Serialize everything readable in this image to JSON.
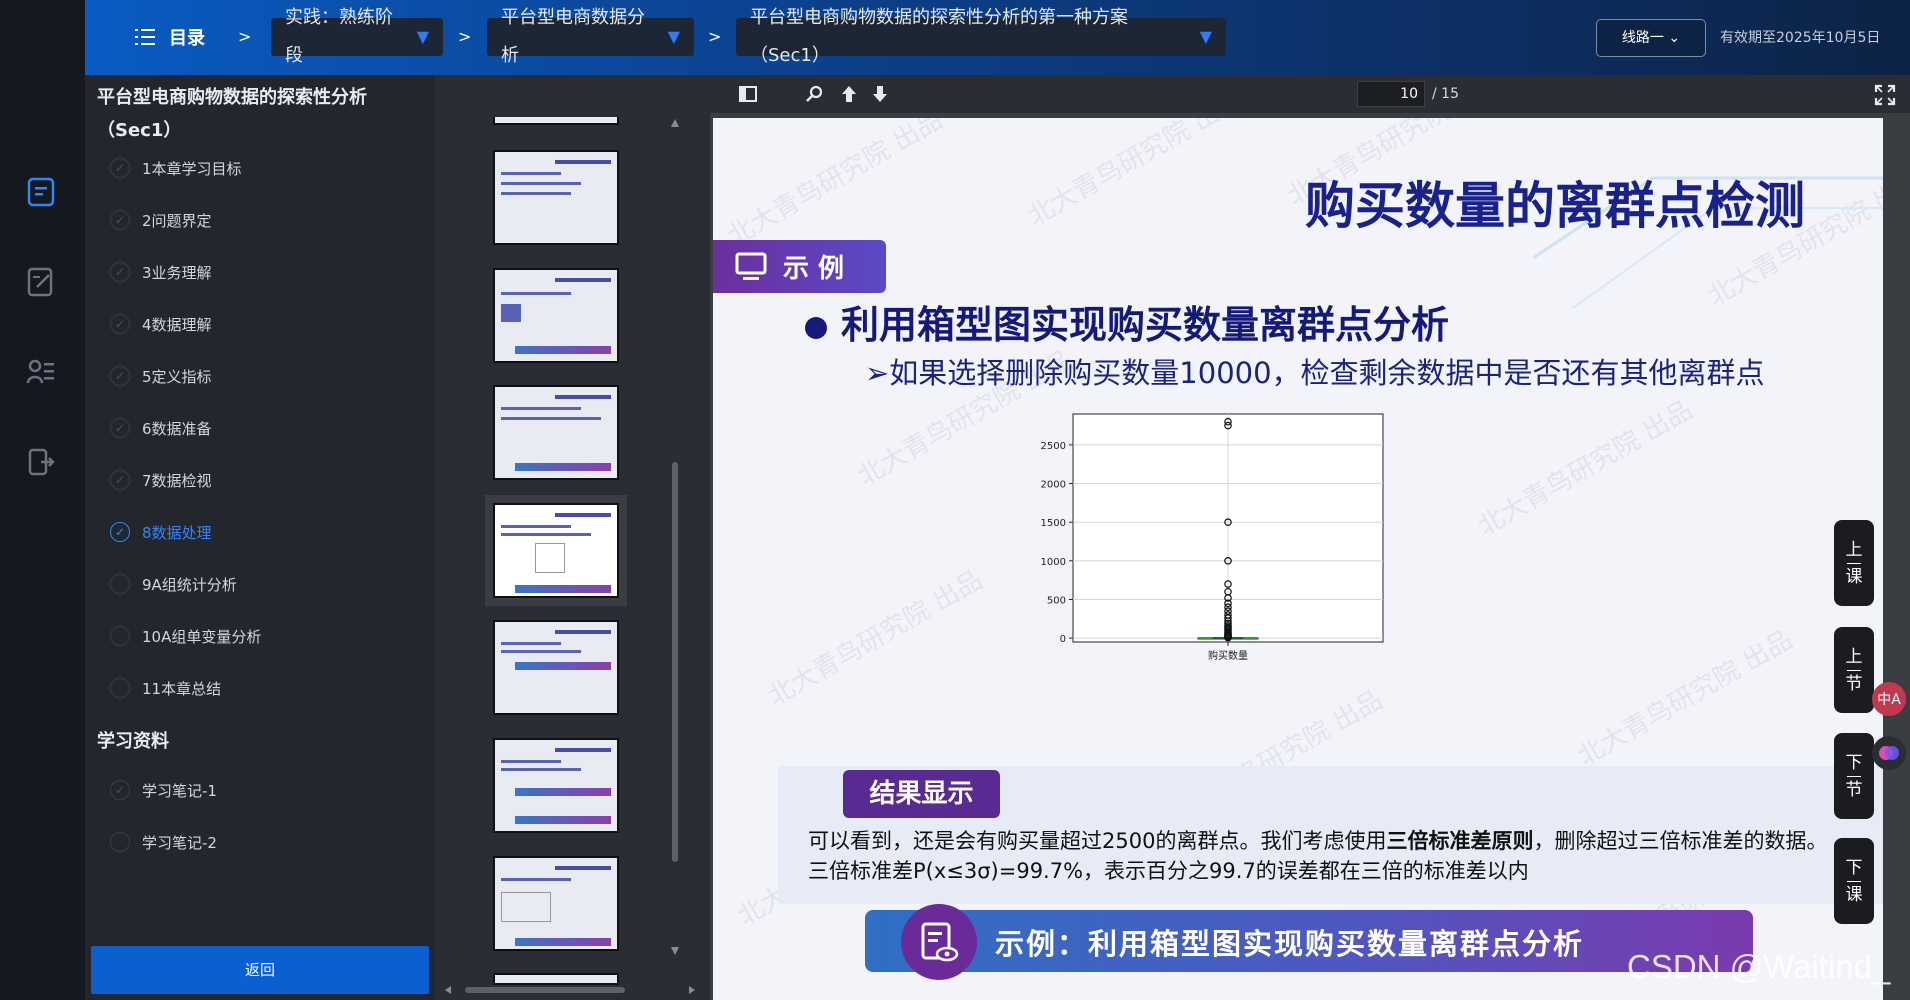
{
  "topbar": {
    "toc_label": "目录",
    "crumbs": [
      "实践：熟练阶段",
      "平台型电商数据分析",
      "平台型电商购物数据的探索性分析的第一种方案（Sec1）"
    ],
    "separator": ">",
    "route_label": "线路一",
    "expiry": "有效期至2025年10月5日"
  },
  "sidebar": {
    "title": "平台型电商购物数据的探索性分析（Sec1）",
    "items": [
      {
        "label": "1本章学习目标",
        "checked": false
      },
      {
        "label": "2问题界定",
        "checked": false
      },
      {
        "label": "3业务理解",
        "checked": false
      },
      {
        "label": "4数据理解",
        "checked": false
      },
      {
        "label": "5定义指标",
        "checked": false
      },
      {
        "label": "6数据准备",
        "checked": false
      },
      {
        "label": "7数据检视",
        "checked": false
      },
      {
        "label": "8数据处理",
        "checked": true
      },
      {
        "label": "9A组统计分析",
        "checked": false
      },
      {
        "label": "10A组单变量分析",
        "checked": false
      },
      {
        "label": "11本章总结",
        "checked": false
      }
    ],
    "materials_title": "学习资料",
    "materials": [
      {
        "label": "学习笔记-1"
      },
      {
        "label": "学习笔记-2"
      }
    ],
    "back_label": "返回"
  },
  "viewer": {
    "current_page": "10",
    "total_pages": "/ 15"
  },
  "slide": {
    "title": "购买数量的离群点检测",
    "example_tag": "示  例",
    "bullet1": "利用箱型图实现购买数量离群点分析",
    "bullet2": "➢如果选择删除购买数量10000，检查剩余数据中是否还有其他离群点",
    "result_tag": "结果显示",
    "result_text_1": "可以看到，还是会有购买量超过2500的离群点。我们考虑使用",
    "result_text_bold": "三倍标准差原则",
    "result_text_2": "，删除超过三倍标准差的数据。三倍标准差P(x≤3σ)=99.7%，表示百分之99.7的误差都在三倍的标准差以内",
    "banner": "示例：利用箱型图实现购买数量离群点分析",
    "watermark": "北大青鸟研究院 出品"
  },
  "side_buttons": [
    {
      "label_top": "上",
      "label_bottom": "课"
    },
    {
      "label_top": "上",
      "label_bottom": "节"
    },
    {
      "label_top": "下",
      "label_bottom": "节"
    },
    {
      "label_top": "下",
      "label_bottom": "课"
    }
  ],
  "fab_translate": "中A",
  "footer_watermark": "CSDN @Waitind_",
  "colors": {
    "accent": "#0b5fd1",
    "active_item": "#2f86ff",
    "slide_title": "#19218d",
    "tag_purple": "#5a2a93"
  },
  "chart_data": {
    "type": "box",
    "xlabel": "购买数量",
    "categories": [
      "购买数量"
    ],
    "ylim": [
      -50,
      2900
    ],
    "yticks": [
      0,
      500,
      1000,
      1500,
      2000,
      2500
    ],
    "box": {
      "q1": 1,
      "median": 1,
      "q3": 2,
      "whisker_low": 1,
      "whisker_high": 4
    },
    "outliers": [
      2800,
      2750,
      1500,
      1000,
      700,
      600,
      520,
      450,
      400,
      350,
      300,
      260,
      220,
      190,
      160,
      140,
      120,
      100,
      80,
      65,
      50,
      40,
      30,
      20,
      12,
      8,
      5
    ],
    "grid": true
  }
}
